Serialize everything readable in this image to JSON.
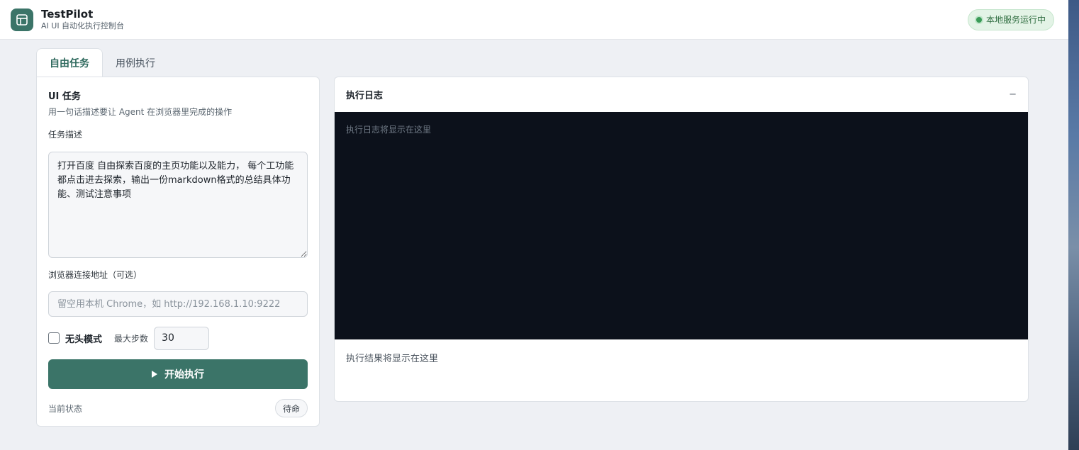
{
  "header": {
    "title": "TestPilot",
    "subtitle": "AI UI 自动化执行控制台",
    "status": "本地服务运行中"
  },
  "tabs": [
    {
      "label": "自由任务",
      "active": true
    },
    {
      "label": "用例执行",
      "active": false
    }
  ],
  "task_panel": {
    "title": "UI 任务",
    "subtitle": "用一句话描述要让 Agent 在浏览器里完成的操作",
    "task_label": "任务描述",
    "task_value": "打开百度 自由探索百度的主页功能以及能力， 每个工功能都点击进去探索，输出一份markdown格式的总结具体功能、测试注意事项",
    "browser_label": "浏览器连接地址（可选）",
    "browser_value": "",
    "browser_placeholder": "留空用本机 Chrome，如 http://192.168.1.10:9222",
    "headless_label": "无头模式",
    "headless_checked": false,
    "max_steps_label": "最大步数",
    "max_steps_value": "30",
    "run_label": "开始执行",
    "state_label": "当前状态",
    "state_value": "待命"
  },
  "log_panel": {
    "title": "执行日志",
    "collapse_label": "−",
    "log_placeholder": "执行日志将显示在这里",
    "result_placeholder": "执行结果将显示在这里"
  },
  "colors": {
    "accent": "#3b7468",
    "log_bg": "#0c111b",
    "status_bg": "#e3f3e6"
  },
  "icons": {
    "logo": "layout-icon",
    "run": "play-icon",
    "status": "status-dot-icon"
  }
}
